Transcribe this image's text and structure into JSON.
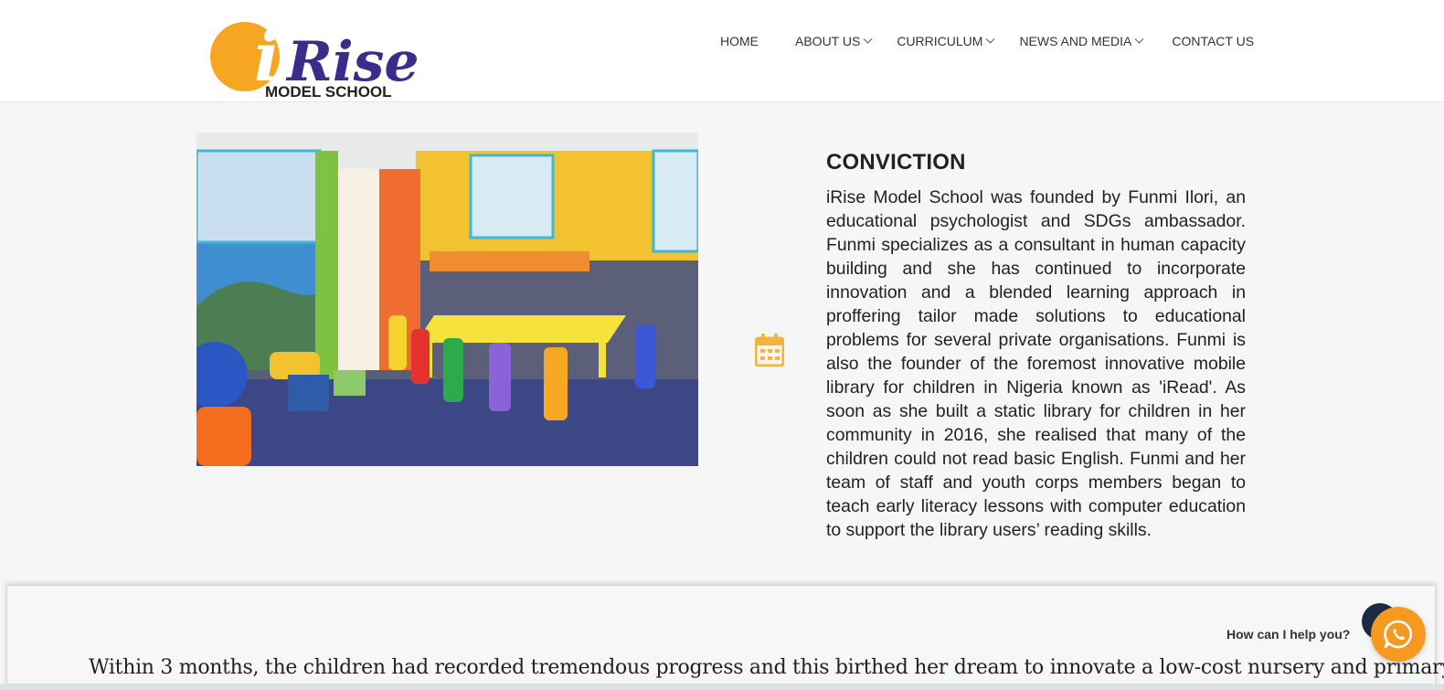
{
  "logo": {
    "brand": "iRise",
    "subtitle": "MODEL SCHOOL"
  },
  "nav": {
    "items": [
      {
        "label": "HOME"
      },
      {
        "label": "ABOUT US"
      },
      {
        "label": "CURRICULUM"
      },
      {
        "label": "NEWS AND MEDIA"
      },
      {
        "label": "CONTACT US"
      }
    ]
  },
  "section": {
    "title": "CONVICTION",
    "body": "iRise Model School was founded by Funmi Ilori, an educational psychologist and SDGs ambassador. Funmi specializes as a consultant in human capacity building and she has continued to incorporate innovation and a blended learning approach in proffering tailor made solutions to educational problems for several private organisations. Funmi is also the founder of the foremost innovative mobile library for children in Nigeria known as 'iRead'. As soon as she built a static library for children in her community in 2016, she realised that many of the children could not read basic English. Funmi and her team of staff and youth corps members began to teach early literacy lessons with computer education to support the library users’ reading skills."
  },
  "bottom": {
    "text": "Within 3 months, the children had recorded tremendous progress and this birthed her dream to innovate a low-cost nursery and primary"
  },
  "chat": {
    "prompt": "How can I help you?"
  },
  "colors": {
    "accent": "#f59a1e",
    "brand_purple": "#3a2c8c",
    "logo_orange": "#f6a623",
    "chat_dark": "#1e2a44"
  },
  "icons": {
    "calendar": "calendar-icon",
    "whatsapp": "whatsapp-icon",
    "chevron": "chevron-down-icon"
  }
}
